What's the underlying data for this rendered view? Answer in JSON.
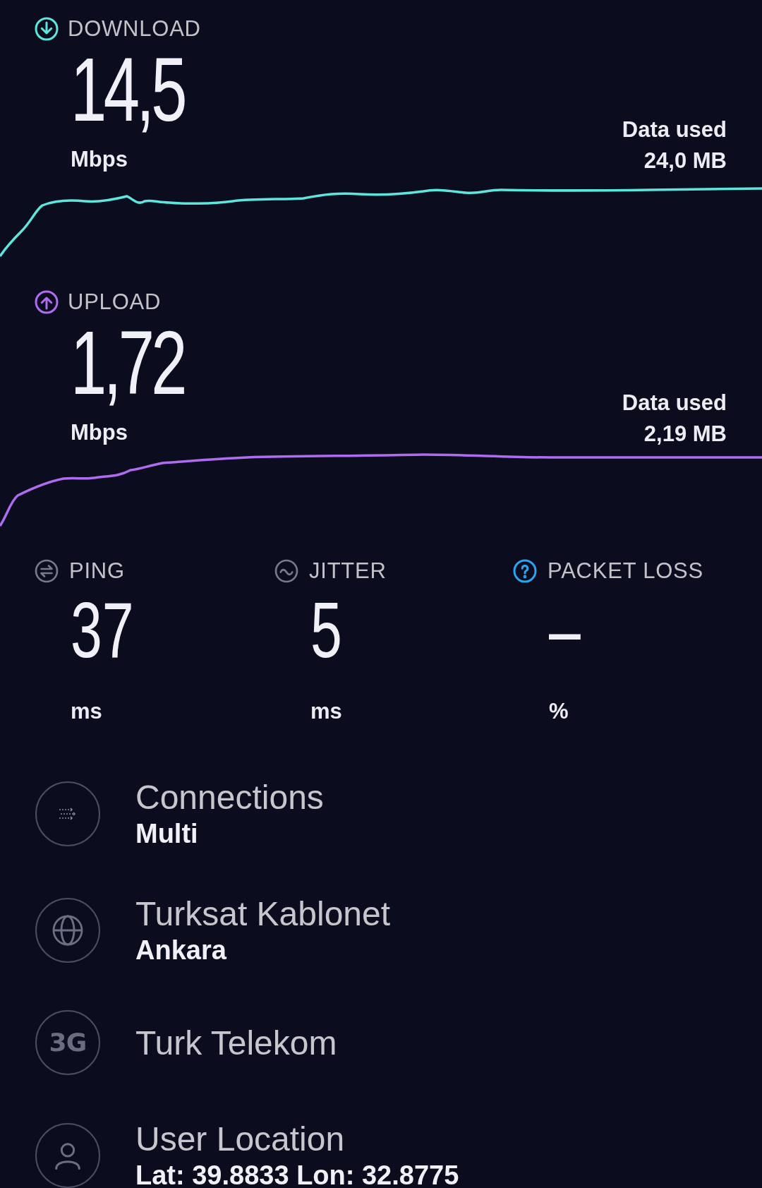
{
  "results": [
    {
      "kind": "download",
      "label": "DOWNLOAD",
      "value": "14,5",
      "unit": "Mbps",
      "data_label": "Data used",
      "data_value": "24,0 MB",
      "color": "#5ee6dc"
    },
    {
      "kind": "upload",
      "label": "UPLOAD",
      "value": "1,72",
      "unit": "Mbps",
      "data_label": "Data used",
      "data_value": "2,19 MB",
      "color": "#b06cf0"
    }
  ],
  "metrics": [
    {
      "kind": "ping",
      "label": "PING",
      "value": "37",
      "unit": "ms"
    },
    {
      "kind": "jitter",
      "label": "JITTER",
      "value": "5",
      "unit": "ms"
    },
    {
      "kind": "packet_loss",
      "label": "PACKET LOSS",
      "value": "–",
      "unit": "%"
    }
  ],
  "details": [
    {
      "kind": "connections",
      "title": "Connections",
      "subtitle": "Multi"
    },
    {
      "kind": "server",
      "title": "Turksat Kablonet",
      "subtitle": "Ankara"
    },
    {
      "kind": "network",
      "badge": "3G",
      "title": "Turk Telekom"
    },
    {
      "kind": "location",
      "title": "User Location",
      "subtitle": "Lat: 39.8833 Lon: 32.8775"
    }
  ]
}
